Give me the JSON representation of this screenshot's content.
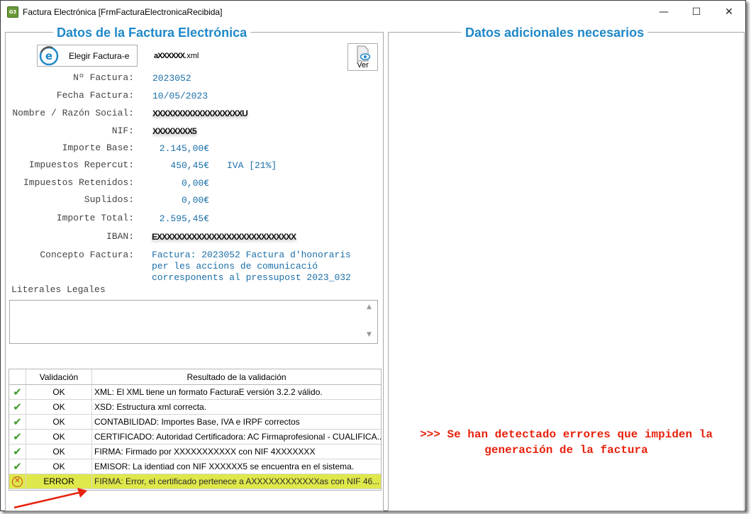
{
  "window": {
    "title": "Factura Electrónica [FrmFacturaElectronicaRecibida]",
    "app_icon": "G3",
    "minimize": "—",
    "maximize": "☐",
    "close": "✕"
  },
  "left_panel": {
    "title": "Datos de la Factura Electrónica",
    "elegir_button": "Elegir Factura-e",
    "filename_redacted": "aXXXXXX",
    "filename_suffix": ".xml",
    "ver_button": "Ver",
    "fields": {
      "numero_label": "Nº Factura:",
      "numero_value": "2023052",
      "fecha_label": "Fecha Factura:",
      "fecha_value": "10/05/2023",
      "nombre_label": "Nombre / Razón Social:",
      "nombre_value": "XXXXXXXXXXXXXXXXXXU",
      "nif_label": "NIF:",
      "nif_value": "XXXXXXXX5",
      "base_label": "Importe Base:",
      "base_value": "2.145,00€",
      "repercut_label": "Impuestos Repercut:",
      "repercut_value": "450,45€",
      "iva_value": "IVA [21%]",
      "retenidos_label": "Impuestos Retenidos:",
      "retenidos_value": "0,00€",
      "suplidos_label": "Suplidos:",
      "suplidos_value": "0,00€",
      "total_label": "Importe Total:",
      "total_value": "2.595,45€",
      "iban_label": "IBAN:",
      "iban_value": "EXXXXXXXXXXXXXXXXXXXXXXXXXXXX",
      "concepto_label": "Concepto Factura:",
      "concepto_value": "Factura: 2023052 Factura d'honoraris per les accions de comunicació corresponents al pressupost 2023_032"
    },
    "literales_label": "Literales Legales",
    "literales_value": ""
  },
  "validation_grid": {
    "col_validacion": "Validación",
    "col_resultado": "Resultado de la validación",
    "rows": [
      {
        "status": "OK",
        "result": "XML: El XML tiene un formato FacturaE versión 3.2.2 válido."
      },
      {
        "status": "OK",
        "result": "XSD: Estructura xml correcta."
      },
      {
        "status": "OK",
        "result": "CONTABILIDAD: Importes Base, IVA e IRPF correctos"
      },
      {
        "status": "OK",
        "result": "CERTIFICADO: Autoridad Certificadora: AC Firmaprofesional - CUALIFICA..."
      },
      {
        "status": "OK",
        "result": "FIRMA: Firmado por XXXXXXXXXXX con NIF 4XXXXXXX"
      },
      {
        "status": "OK",
        "result": "EMISOR: La identiad con NIF XXXXXX5 se encuentra en el sistema."
      },
      {
        "status": "ERROR",
        "result": "FIRMA: Error, el certificado pertenece a AXXXXXXXXXXXXas con NIF 46..."
      }
    ]
  },
  "right_panel": {
    "title": "Datos adicionales necesarios",
    "error_line1": ">>> Se han detectado errores que impiden la",
    "error_line2": "generación de la factura"
  },
  "colors": {
    "accent": "#1f88c9",
    "value_text": "#1b6fa8",
    "error_text": "#e8220d",
    "error_row": "#dfe84a",
    "ok_check": "#3f9a2c"
  }
}
